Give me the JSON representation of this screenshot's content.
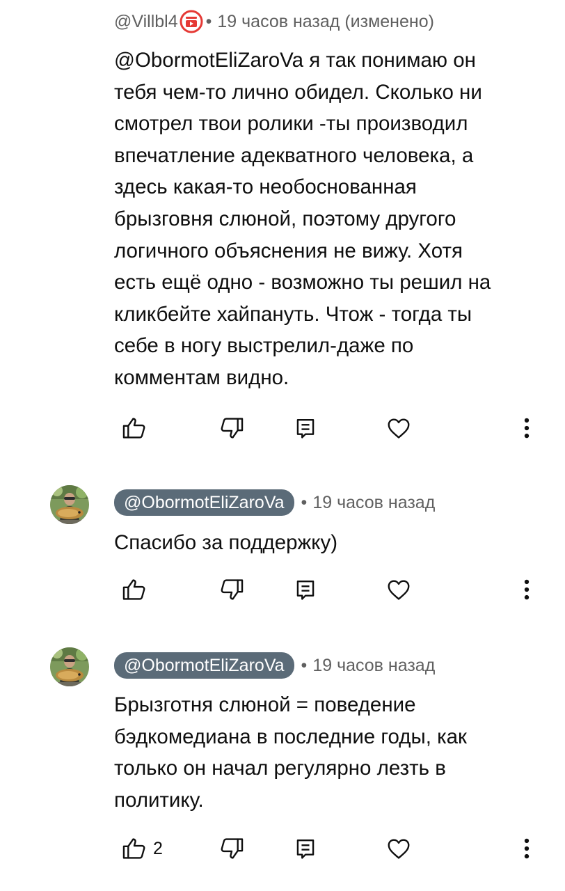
{
  "comments": [
    {
      "author": "@Villbl4",
      "time": "19 часов назад (изменено)",
      "lines": [
        "@ObormotEliZaroVa  я так понимаю он",
        "тебя чем-то лично обидел. Сколько ни",
        "смотрел твои ролики -ты производил",
        "впечатление адекватного человека, а",
        "здесь какая-то необоснованная",
        "брызговня слюной, поэтому другого",
        "логичного объяснения не вижу. Хотя",
        "есть ещё одно - возможно ты решил на",
        "кликбейте хайпануть. Чтож - тогда ты",
        "себе в ногу выстрелил-даже по",
        "комментам видно."
      ],
      "like_count": ""
    },
    {
      "author": "@ObormotEliZaroVa",
      "time": "19 часов назад",
      "lines": [
        "Спасибо за поддержку)"
      ],
      "like_count": ""
    },
    {
      "author": "@ObormotEliZaroVa",
      "time": "19 часов назад",
      "lines": [
        "Брызготня слюной = поведение",
        "бэдкомедиана в последние годы, как",
        "только он начал регулярно лезть в",
        "политику."
      ],
      "like_count": "2"
    }
  ],
  "separator": "•",
  "icons": {
    "like": "thumb-up-icon",
    "dislike": "thumb-down-icon",
    "reply": "reply-icon",
    "heart": "heart-icon",
    "more": "more-vert-icon",
    "badge": "member-badge-icon"
  },
  "colors": {
    "text": "#0f0f0f",
    "meta": "#606060",
    "pill": "#5b6b78",
    "badge": "#e53935"
  }
}
